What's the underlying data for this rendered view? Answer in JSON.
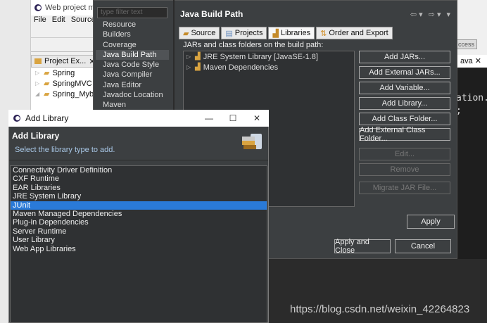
{
  "background_window": {
    "title": "Web project m",
    "menu": [
      "File",
      "Edit",
      "Source"
    ],
    "project_explorer_tab": "Project Ex...",
    "tree": [
      "Spring",
      "SpringMVC",
      "Spring_Myba"
    ],
    "right_tab": "ava",
    "right_access": "ccess",
    "right_code": [
      "ation.",
      ";"
    ]
  },
  "properties": {
    "filter_placeholder": "type filter text",
    "nav": [
      "Resource",
      "Builders",
      "Coverage",
      "Java Build Path",
      "Java Code Style",
      "Java Compiler",
      "Java Editor",
      "Javadoc Location",
      "Maven"
    ],
    "selected_nav": "Java Build Path",
    "title": "Java Build Path",
    "tabs": [
      "Source",
      "Projects",
      "Libraries",
      "Order and Export"
    ],
    "active_tab": "Libraries",
    "jar_label": "JARs and class folders on the build path:",
    "jars": [
      "JRE System Library [JavaSE-1.8]",
      "Maven Dependencies"
    ],
    "buttons": {
      "add_jars": "Add JARs...",
      "add_external_jars": "Add External JARs...",
      "add_variable": "Add Variable...",
      "add_library": "Add Library...",
      "add_class_folder": "Add Class Folder...",
      "add_external_class_folder": "Add External Class Folder...",
      "edit": "Edit...",
      "remove": "Remove",
      "migrate_jar": "Migrate JAR File..."
    },
    "apply": "Apply",
    "apply_and_close": "Apply and Close",
    "cancel": "Cancel"
  },
  "add_library": {
    "window_title": "Add Library",
    "header_title": "Add Library",
    "header_subtitle": "Select the library type to add.",
    "libraries": [
      "Connectivity Driver Definition",
      "CXF Runtime",
      "EAR Libraries",
      "JRE System Library",
      "JUnit",
      "Maven Managed Dependencies",
      "Plug-in Dependencies",
      "Server Runtime",
      "User Library",
      "Web App Libraries"
    ],
    "selected": "JUnit"
  },
  "watermark": "https://blog.csdn.net/weixin_42264823",
  "colors": {
    "selection": "#2a7ad8",
    "dialog_bg": "#3c3f41",
    "list_bg": "#2f3133"
  }
}
